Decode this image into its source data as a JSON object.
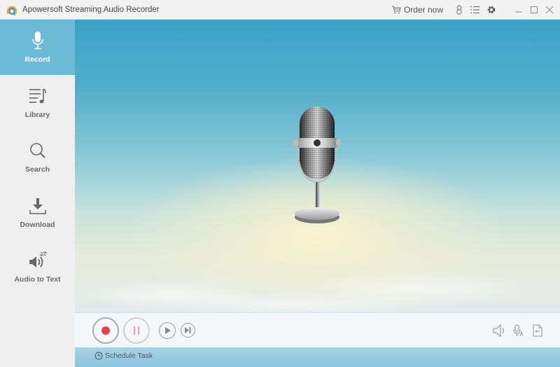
{
  "window": {
    "title": "Apowersoft Streaming Audio Recorder",
    "logo_icon": "headphone-logo-icon",
    "order_label": "Order now",
    "order_icon": "cart-icon",
    "icons": [
      "user-icon",
      "list-menu-icon",
      "gear-icon"
    ],
    "controls": [
      "minimize-icon",
      "maximize-icon",
      "close-icon"
    ]
  },
  "sidebar": {
    "items": [
      {
        "label": "Record",
        "icon": "microphone-icon",
        "active": true
      },
      {
        "label": "Library",
        "icon": "music-list-icon",
        "active": false
      },
      {
        "label": "Search",
        "icon": "search-icon",
        "active": false
      },
      {
        "label": "Download",
        "icon": "download-icon",
        "active": false
      },
      {
        "label": "Audio to Text",
        "icon": "speaker-convert-icon",
        "active": false
      }
    ]
  },
  "main": {
    "illustration": "vintage-microphone",
    "controls": {
      "record": "record-button",
      "pause": "pause-button",
      "play": "play-button",
      "skip": "skip-next-button"
    },
    "right_tools": [
      "system-sound-icon",
      "microphone-input-icon",
      "audio-file-icon"
    ],
    "schedule_label": "Schedule Task"
  },
  "colors": {
    "accent": "#6bbad6",
    "record_red": "#e5434b",
    "pause_pink": "#f2a0a6"
  }
}
